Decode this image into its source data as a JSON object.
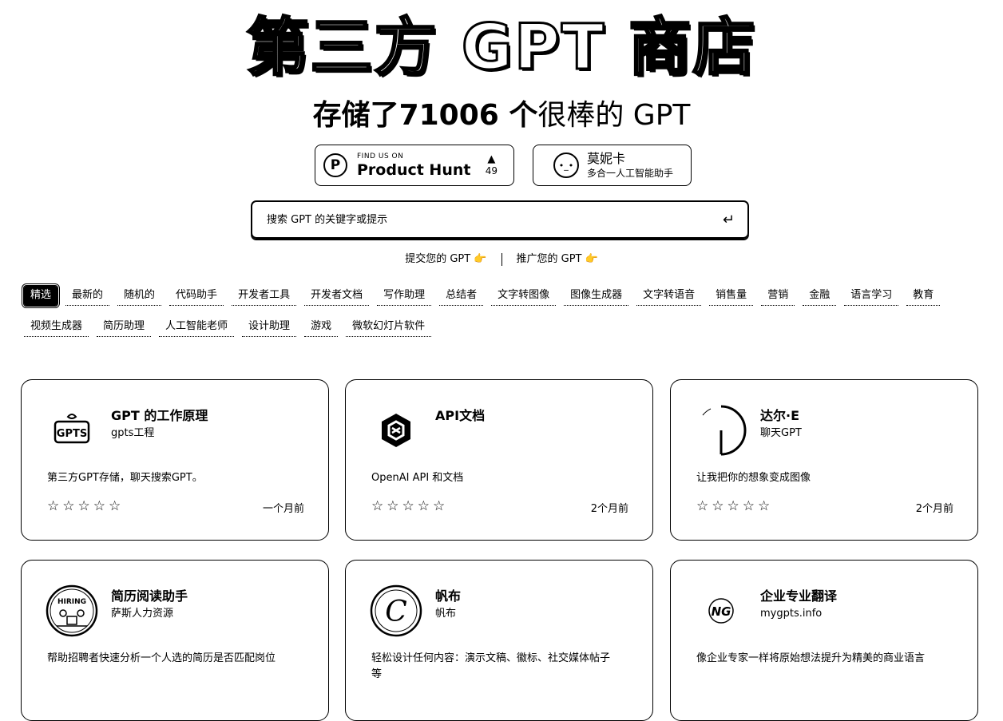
{
  "hero": {
    "title": "第三方 GPT 商店",
    "subtitle_bold": "存储了71006 个",
    "subtitle_light": "很棒的 GPT"
  },
  "badges": {
    "producthunt": {
      "small": "FIND US ON",
      "big": "Product Hunt",
      "votes": "49",
      "logo_letter": "P",
      "arrow": "▲"
    },
    "monica": {
      "name": "莫妮卡",
      "desc": "多合一人工智能助手",
      "logo": "•_•"
    }
  },
  "search": {
    "placeholder": "搜索 GPT 的关键字或提示",
    "enter_icon": "↵"
  },
  "links": {
    "submit": "提交您的 GPT 👉",
    "promote": "推广您的 GPT 👉"
  },
  "categories": [
    "精选",
    "最新的",
    "随机的",
    "代码助手",
    "开发者工具",
    "开发者文档",
    "写作助理",
    "总结者",
    "文字转图像",
    "图像生成器",
    "文字转语音",
    "销售量",
    "营销",
    "金融",
    "语言学习",
    "教育",
    "视频生成器",
    "简历助理",
    "人工智能老师",
    "设计助理",
    "游戏",
    "微软幻灯片软件"
  ],
  "cards": [
    {
      "title": "GPT 的工作原理",
      "author": "gpts工程",
      "desc": "第三方GPT存储，聊天搜索GPT。",
      "stars": "☆☆☆☆☆",
      "time": "一个月前",
      "icon": "gpts-icon",
      "icon_text": "GPTS"
    },
    {
      "title": "API文档",
      "author": "",
      "desc": "OpenAI API 和文档",
      "stars": "☆☆☆☆☆",
      "time": "2个月前",
      "icon": "openai-icon",
      "icon_text": ""
    },
    {
      "title": "达尔·E",
      "author": "聊天GPT",
      "desc": "让我把你的想象变成图像",
      "stars": "☆☆☆☆☆",
      "time": "2个月前",
      "icon": "dalle-icon",
      "icon_text": ""
    },
    {
      "title": "简历阅读助手",
      "author": "萨斯人力资源",
      "desc": "帮助招聘者快速分析一个人选的简历是否匹配岗位",
      "stars": "",
      "time": "",
      "icon": "hiring-icon",
      "icon_text": "HIRING"
    },
    {
      "title": "帆布",
      "author": "帆布",
      "desc": "轻松设计任何内容：演示文稿、徽标、社交媒体帖子等",
      "stars": "",
      "time": "",
      "icon": "canva-icon",
      "icon_text": "C"
    },
    {
      "title": "企业专业翻译",
      "author": "mygpts.info",
      "desc": "像企业专家一样将原始想法提升为精美的商业语言",
      "stars": "",
      "time": "",
      "icon": "translate-icon",
      "icon_text": "NG"
    }
  ]
}
